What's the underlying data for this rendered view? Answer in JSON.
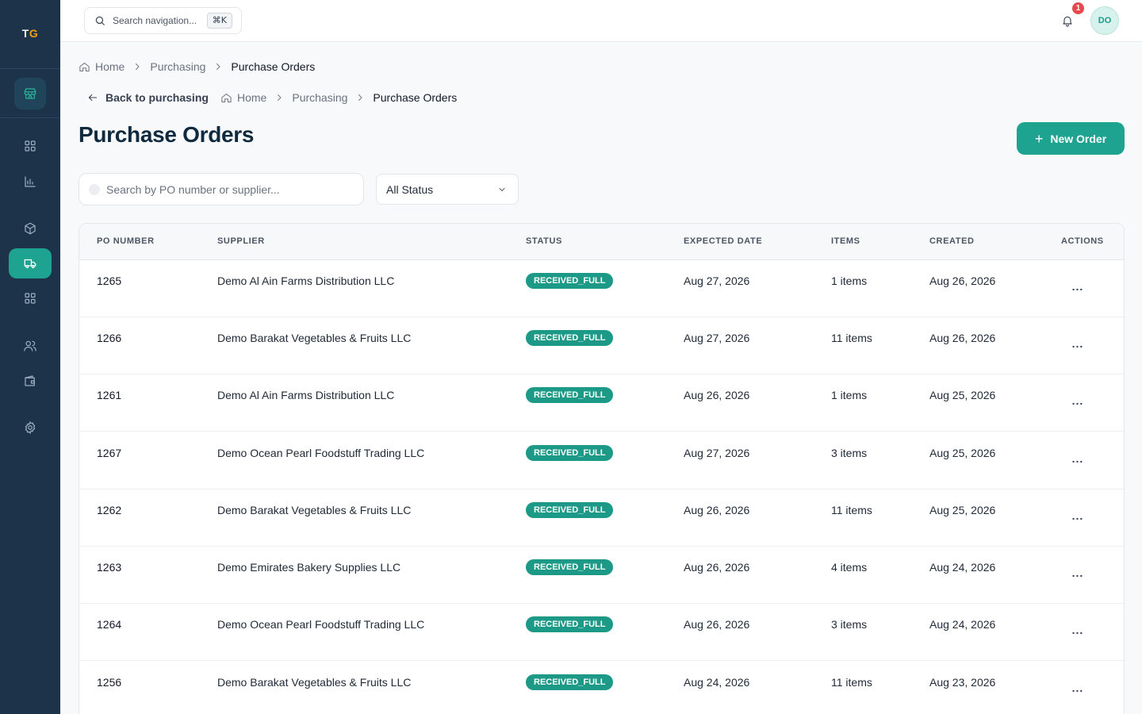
{
  "app": {
    "logo_t": "T",
    "logo_g": "G"
  },
  "topbar": {
    "search_placeholder": "Search navigation...",
    "shortcut": "⌘K",
    "notification_count": "1",
    "avatar_initials": "DO"
  },
  "breadcrumb_top": {
    "home": "Home",
    "section": "Purchasing",
    "current": "Purchase Orders"
  },
  "breadcrumb_inner": {
    "back": "Back to purchasing",
    "home": "Home",
    "section": "Purchasing",
    "current": "Purchase Orders"
  },
  "page": {
    "title": "Purchase Orders",
    "new_button": "New Order",
    "new_button_icon": "+"
  },
  "filters": {
    "search_placeholder": "Search by PO number or supplier...",
    "status_selected": "All Status"
  },
  "table": {
    "headers": [
      "PO NUMBER",
      "SUPPLIER",
      "STATUS",
      "EXPECTED DATE",
      "ITEMS",
      "CREATED",
      "ACTIONS"
    ],
    "rows": [
      {
        "po": "1265",
        "supplier": "Demo Al Ain Farms Distribution LLC",
        "status": "RECEIVED_FULL",
        "expected": "Aug 27, 2026",
        "items": "1 items",
        "created": "Aug 26, 2026"
      },
      {
        "po": "1266",
        "supplier": "Demo Barakat Vegetables & Fruits LLC",
        "status": "RECEIVED_FULL",
        "expected": "Aug 27, 2026",
        "items": "11 items",
        "created": "Aug 26, 2026"
      },
      {
        "po": "1261",
        "supplier": "Demo Al Ain Farms Distribution LLC",
        "status": "RECEIVED_FULL",
        "expected": "Aug 26, 2026",
        "items": "1 items",
        "created": "Aug 25, 2026"
      },
      {
        "po": "1267",
        "supplier": "Demo Ocean Pearl Foodstuff Trading LLC",
        "status": "RECEIVED_FULL",
        "expected": "Aug 27, 2026",
        "items": "3 items",
        "created": "Aug 25, 2026"
      },
      {
        "po": "1262",
        "supplier": "Demo Barakat Vegetables & Fruits LLC",
        "status": "RECEIVED_FULL",
        "expected": "Aug 26, 2026",
        "items": "11 items",
        "created": "Aug 25, 2026"
      },
      {
        "po": "1263",
        "supplier": "Demo Emirates Bakery Supplies LLC",
        "status": "RECEIVED_FULL",
        "expected": "Aug 26, 2026",
        "items": "4 items",
        "created": "Aug 24, 2026"
      },
      {
        "po": "1264",
        "supplier": "Demo Ocean Pearl Foodstuff Trading LLC",
        "status": "RECEIVED_FULL",
        "expected": "Aug 26, 2026",
        "items": "3 items",
        "created": "Aug 24, 2026"
      },
      {
        "po": "1256",
        "supplier": "Demo Barakat Vegetables & Fruits LLC",
        "status": "RECEIVED_FULL",
        "expected": "Aug 24, 2026",
        "items": "11 items",
        "created": "Aug 23, 2026"
      }
    ],
    "action_glyph": "..."
  },
  "colors": {
    "sidebar": "#1c3349",
    "accent": "#1ea391",
    "status_pill": "#1c9a87",
    "badge": "#e5484d"
  },
  "icons": [
    "store-icon",
    "dashboard-icon",
    "chart-icon",
    "box-icon",
    "truck-icon",
    "grid-icon",
    "users-icon",
    "wallet-icon",
    "gear-icon",
    "search-icon",
    "bell-icon",
    "home-icon",
    "chevron-right-icon",
    "arrow-left-icon",
    "chevron-down-icon"
  ]
}
